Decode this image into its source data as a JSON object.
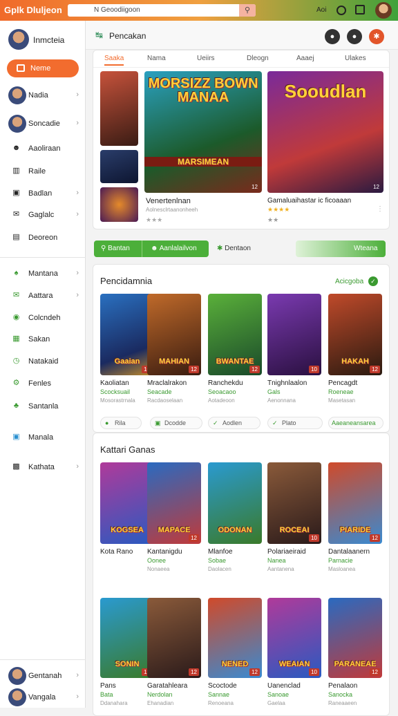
{
  "topbar": {
    "logo": "Gplk Dluljeon",
    "search_text": "N Geoodiigoon",
    "search_icon": "search-icon",
    "right_text": "Aoi"
  },
  "sidebar": {
    "profile": "Inmcteia",
    "home": "Neme",
    "items": [
      {
        "label": "Nadia",
        "icon": "avatar"
      },
      {
        "label": "Soncadie",
        "icon": "avatar"
      },
      {
        "label": "Aaoliraan",
        "icon": "user-icon"
      },
      {
        "label": "Raile",
        "icon": "chart-icon"
      },
      {
        "label": "Badlan",
        "icon": "folder-icon"
      },
      {
        "label": "Gaglalc",
        "icon": "chat-icon"
      },
      {
        "label": "Deoreon",
        "icon": "doc-icon"
      },
      {
        "label": "Mantana",
        "icon": "people-icon"
      },
      {
        "label": "Aattara",
        "icon": "mail-icon"
      },
      {
        "label": "Colcndeh",
        "icon": "target-icon"
      },
      {
        "label": "Sakan",
        "icon": "calendar-icon"
      },
      {
        "label": "Natakaid",
        "icon": "clock-icon"
      },
      {
        "label": "Fenles",
        "icon": "gear-icon"
      },
      {
        "label": "Santanla",
        "icon": "group-icon"
      },
      {
        "label": "Manala",
        "icon": "image-icon"
      },
      {
        "label": "Kathata",
        "icon": "box-icon"
      },
      {
        "label": "Gentanah",
        "icon": "avatar"
      },
      {
        "label": "Vangala",
        "icon": "avatar"
      }
    ]
  },
  "header": {
    "title": "Pencakan"
  },
  "featured": {
    "tabs": [
      "Saaka",
      "Nama",
      "Ueiirs",
      "Dleogn",
      "Aaaej",
      "Ulakes"
    ],
    "hero1_art": "MORSIZZ BOWN MANAA",
    "hero1_banner": "MARSIMEAN",
    "hero1_title": "Venertenlnan",
    "hero1_sub": "Aolnesclrtaanonheeh",
    "hero1_badge": "12",
    "hero2_art": "Sooudlan",
    "hero2_title": "Gamaluaihastar ic ficoaaan",
    "hero2_badge": "12"
  },
  "filters": {
    "btn1": "Bantan",
    "btn2": "Aanlalailvon",
    "btn3": "Dentaon",
    "btn4": "Wteana"
  },
  "popular": {
    "title": "Pencidamnia",
    "link": "Acicgoba",
    "cards": [
      {
        "title": "Kaoliatan",
        "sub": "Scocksuail",
        "meta": "Mosorastrnala",
        "art": "Gaaian",
        "badge": "10"
      },
      {
        "title": "Mraclalrakon",
        "sub": "Seacade",
        "meta": "Racdaoselaan",
        "art": "MAHIAN",
        "badge": "12"
      },
      {
        "title": "Ranchekdu",
        "sub": "Seoacaoo",
        "meta": "Aotadeoon",
        "art": "BWANTAE",
        "badge": "12"
      },
      {
        "title": "Tnighnlaalon",
        "sub": "Gals",
        "meta": "Aenonnana",
        "art": "",
        "badge": "10"
      },
      {
        "title": "Pencagdt",
        "sub": "Roeneae",
        "meta": "Masetasan",
        "art": "HAKAH",
        "badge": "12"
      }
    ],
    "chips": [
      "Rila",
      "Dcodde",
      "Aodlen",
      "Plato",
      "Aaeaneansarea"
    ]
  },
  "games": {
    "title": "Kattari Ganas",
    "row1": [
      {
        "title": "Kota Rano",
        "sub": "",
        "meta": "",
        "art": "KOGSEA",
        "badge": ""
      },
      {
        "title": "Kantanigdu",
        "sub": "Oonee",
        "meta": "Nonaeea",
        "art": "MAPACE",
        "badge": "12"
      },
      {
        "title": "Mlanfoe",
        "sub": "Sobae",
        "meta": "Daolacen",
        "art": "ODONAN",
        "badge": ""
      },
      {
        "title": "Polariaeiraid",
        "sub": "Nanea",
        "meta": "Aantanena",
        "art": "ROCEAI",
        "badge": "10"
      },
      {
        "title": "Dantalaanern",
        "sub": "Parnacie",
        "meta": "Masloanea",
        "art": "PIARIDE",
        "badge": "12"
      }
    ],
    "row2": [
      {
        "title": "Pans",
        "sub": "Bata",
        "meta": "Ddanahara",
        "art": "SONIN",
        "badge": "12"
      },
      {
        "title": "Garatahleara",
        "sub": "Nerdolan",
        "meta": "Ehanadian",
        "art": "",
        "badge": "12"
      },
      {
        "title": "Scoctode",
        "sub": "Sannae",
        "meta": "Renoeana",
        "art": "NENED",
        "badge": "12"
      },
      {
        "title": "Uanenclad",
        "sub": "Sanoae",
        "meta": "Gaelaa",
        "art": "WEAIAN",
        "badge": "10"
      },
      {
        "title": "Penalaon",
        "sub": "Sanocka",
        "meta": "Raneaaeen",
        "art": "PARANEAE",
        "badge": "12"
      }
    ]
  }
}
